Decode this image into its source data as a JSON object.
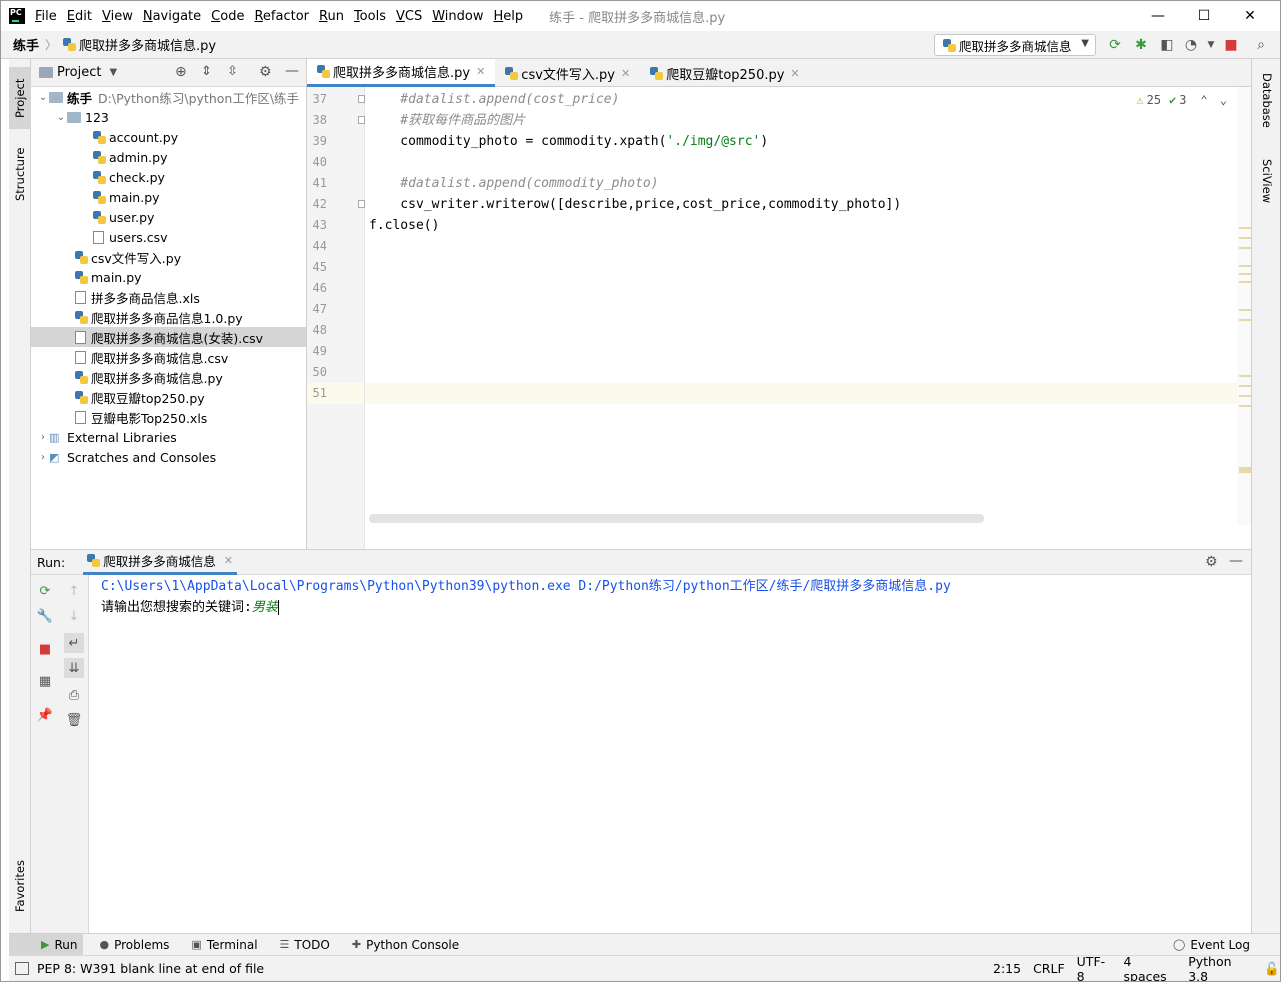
{
  "title_bar": {
    "menu": [
      "File",
      "Edit",
      "View",
      "Navigate",
      "Code",
      "Refactor",
      "Run",
      "Tools",
      "VCS",
      "Window",
      "Help"
    ],
    "window_title": "练手 - 爬取拼多多商城信息.py"
  },
  "nav_bar": {
    "breadcrumb_project": "练手",
    "breadcrumb_file": "爬取拼多多商城信息.py",
    "run_config": "爬取拼多多商城信息"
  },
  "left_stripe": {
    "project": "Project",
    "structure": "Structure",
    "favorites": "Favorites"
  },
  "right_stripe": {
    "database": "Database",
    "sciview": "SciView"
  },
  "project_panel": {
    "title": "Project",
    "root_name": "练手",
    "root_path": "D:\\Python练习\\python工作区\\练手",
    "tree": [
      {
        "label": "123",
        "type": "folder"
      },
      {
        "label": "account.py",
        "type": "py"
      },
      {
        "label": "admin.py",
        "type": "py"
      },
      {
        "label": "check.py",
        "type": "py"
      },
      {
        "label": "main.py",
        "type": "py"
      },
      {
        "label": "user.py",
        "type": "py"
      },
      {
        "label": "users.csv",
        "type": "csv"
      },
      {
        "label": "csv文件写入.py",
        "type": "py"
      },
      {
        "label": "main.py",
        "type": "py"
      },
      {
        "label": "拼多多商品信息.xls",
        "type": "xls"
      },
      {
        "label": "爬取拼多多商品信息1.0.py",
        "type": "py"
      },
      {
        "label": "爬取拼多多商城信息(女装).csv",
        "type": "csv"
      },
      {
        "label": "爬取拼多多商城信息.csv",
        "type": "csv"
      },
      {
        "label": "爬取拼多多商城信息.py",
        "type": "py"
      },
      {
        "label": "爬取豆瓣top250.py",
        "type": "py"
      },
      {
        "label": "豆瓣电影Top250.xls",
        "type": "xls"
      },
      {
        "label": "External Libraries",
        "type": "lib"
      },
      {
        "label": "Scratches and Consoles",
        "type": "scratch"
      }
    ]
  },
  "editor": {
    "tabs": [
      "爬取拼多多商城信息.py",
      "csv文件写入.py",
      "爬取豆瓣top250.py"
    ],
    "warnings": "25",
    "weak_warnings": "3",
    "line_numbers": [
      "37",
      "38",
      "39",
      "40",
      "41",
      "42",
      "43",
      "44",
      "45",
      "46",
      "47",
      "48",
      "49",
      "50",
      "51"
    ],
    "code": {
      "l37": "    #datalist.append(cost_price)",
      "l38": "    #获取每件商品的图片",
      "l39a": "    commodity_photo = commodity.xpath(",
      "l39s": "'./img/@src'",
      "l39b": ")",
      "l41": "    #datalist.append(commodity_photo)",
      "l42": "    csv_writer.writerow([describe,price,cost_price,commodity_photo])",
      "l43": "f.close()"
    }
  },
  "run_panel": {
    "label": "Run:",
    "tab": "爬取拼多多商城信息",
    "console_cmd": "C:\\Users\\1\\AppData\\Local\\Programs\\Python\\Python39\\python.exe D:/Python练习/python工作区/练手/爬取拼多多商城信息.py",
    "prompt": "请输出您想搜索的关键词:",
    "input": "男装"
  },
  "tool_strip": {
    "run": "Run",
    "problems": "Problems",
    "terminal": "Terminal",
    "todo": "TODO",
    "python_console": "Python Console",
    "event_log": "Event Log"
  },
  "status_bar": {
    "message": "PEP 8: W391 blank line at end of file",
    "position": "2:15",
    "line_sep": "CRLF",
    "encoding": "UTF-8",
    "indent": "4 spaces",
    "interpreter": "Python 3.8"
  }
}
